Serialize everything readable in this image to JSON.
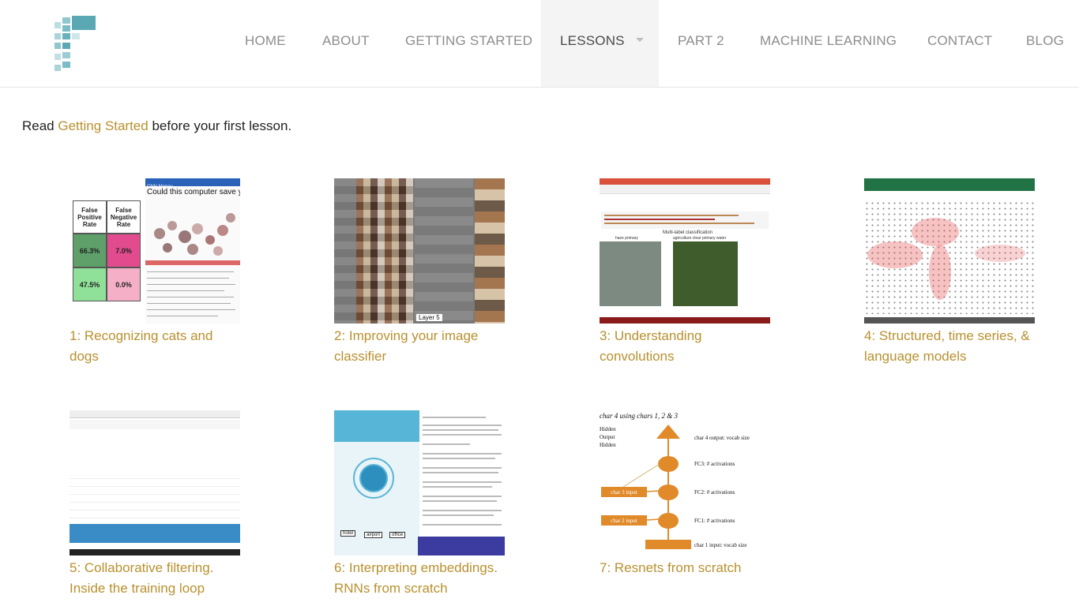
{
  "nav": {
    "items": [
      {
        "label": "HOME"
      },
      {
        "label": "ABOUT"
      },
      {
        "label": "GETTING STARTED"
      },
      {
        "label": "LESSONS"
      },
      {
        "label": "PART 2"
      },
      {
        "label": "MACHINE LEARNING"
      },
      {
        "label": "CONTACT"
      },
      {
        "label": "BLOG"
      }
    ],
    "active": "LESSONS"
  },
  "intro": {
    "prefix": "Read ",
    "link": "Getting Started",
    "suffix": " before your first lesson."
  },
  "lessons": [
    {
      "title_line1": "1: Recognizing cats and",
      "title_line2": "dogs"
    },
    {
      "title_line1": "2: Improving your image",
      "title_line2": "classifier"
    },
    {
      "title_line1": "3: Understanding",
      "title_line2": "convolutions"
    },
    {
      "title_line1": "4: Structured, time series, &",
      "title_line2": "language models"
    },
    {
      "title_line1": "5: Collaborative filtering.",
      "title_line2": "Inside the training loop"
    },
    {
      "title_line1": "6: Interpreting embeddings.",
      "title_line2": "RNNs from scratch"
    },
    {
      "title_line1": "7: Resnets from scratch",
      "title_line2": ""
    }
  ],
  "thumbs": {
    "t1": {
      "headers": [
        "False Positive Rate",
        "False Negative Rate"
      ],
      "values": [
        "66.3%",
        "7.0%",
        "47.5%",
        "0.0%"
      ],
      "brand": "CNN Money",
      "headline": "Could this computer save yo"
    },
    "t2": {
      "layer_label": "Layer 5"
    },
    "t3": {
      "heading": "Multi-label classification",
      "label_a": "haze primary",
      "label_b": "agriculture clear primary water"
    },
    "t7": {
      "title": "char 4 using chars 1, 2 & 3",
      "legend": [
        "Hidden",
        "Output",
        "Hidden"
      ],
      "output_label": "char 4 output: vocab size",
      "fc3": "FC3: # activations",
      "fc2": "FC2: # activations",
      "fc1": "FC1: # activations",
      "char3": "char 3 input",
      "char2": "char 2 input",
      "char1_label": "char 1 input: vocab size"
    },
    "t6": {
      "nodes": [
        "hotel",
        "airport",
        "office"
      ]
    }
  },
  "colors": {
    "link": "#b8912f",
    "nav_text": "#8c8c8c",
    "logo_teal": "#5aa8b3",
    "diagram_orange": "#e08a2a"
  }
}
